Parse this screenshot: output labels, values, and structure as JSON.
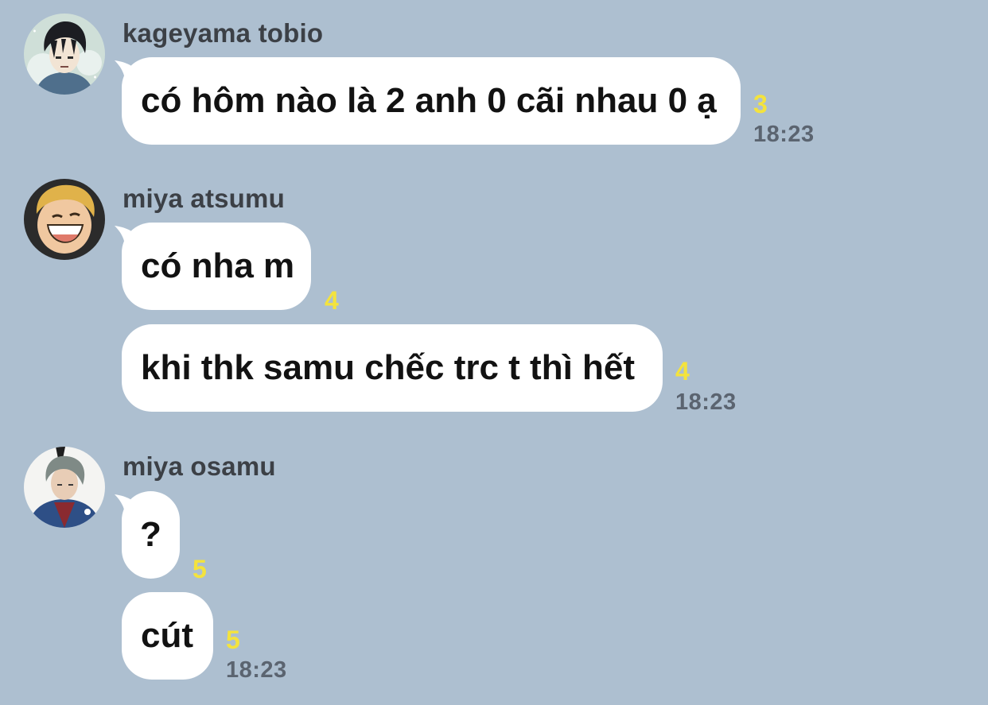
{
  "colors": {
    "background": "#adbfd0",
    "bubble": "#ffffff",
    "read_count": "#f4e33d",
    "timestamp": "#5b6470",
    "sender_name": "#3c4046"
  },
  "messages": [
    {
      "sender": "kageyama tobio",
      "avatar_icon": "kageyama-avatar",
      "bubbles": [
        {
          "text": "có hôm nào là 2 anh 0 cãi nhau 0 ạ",
          "read": "3",
          "time": "18:23"
        }
      ]
    },
    {
      "sender": "miya atsumu",
      "avatar_icon": "atsumu-avatar",
      "bubbles": [
        {
          "text": "có nha m",
          "read": "4"
        },
        {
          "text": "khi thk samu chếc trc t thì hết",
          "read": "4",
          "time": "18:23"
        }
      ]
    },
    {
      "sender": "miya osamu",
      "avatar_icon": "osamu-avatar",
      "bubbles": [
        {
          "text": "?",
          "read": "5"
        },
        {
          "text": "cút",
          "read": "5",
          "time": "18:23"
        }
      ]
    }
  ]
}
